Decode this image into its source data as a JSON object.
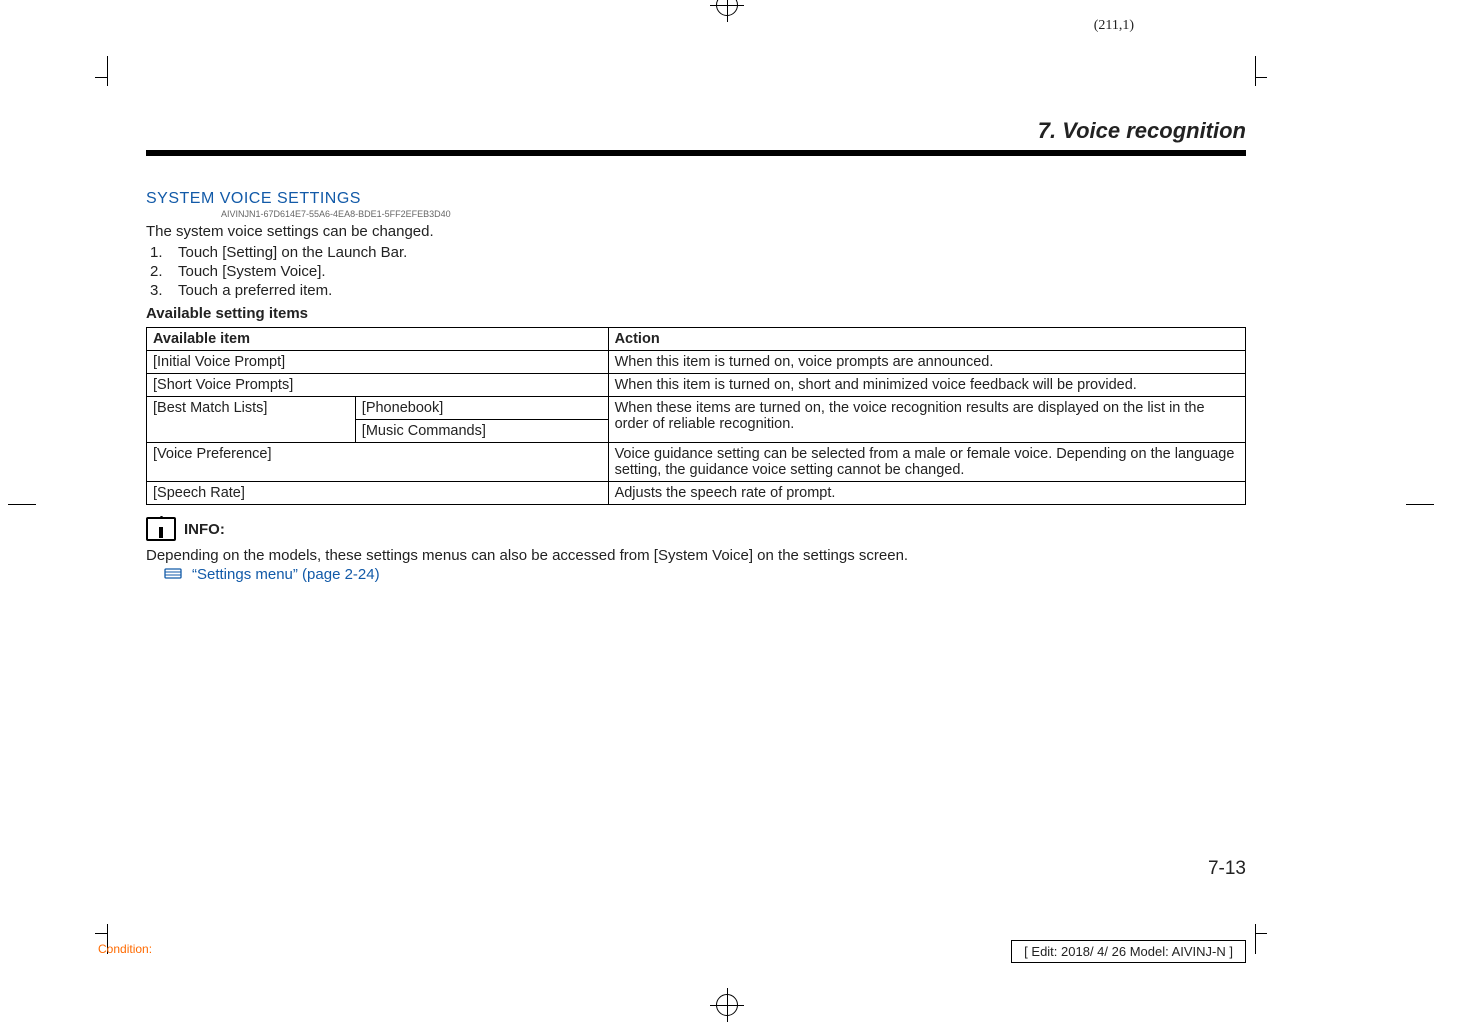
{
  "meta": {
    "corner_page": "(211,1)",
    "condition_label": "Condition:",
    "edit_info": "[ Edit: 2018/ 4/ 26   Model:  AIVINJ-N ]",
    "page_number": "7-13"
  },
  "chapter_title": "7. Voice recognition",
  "section": {
    "heading": "SYSTEM VOICE SETTINGS",
    "guid": "AIVINJN1-67D614E7-55A6-4EA8-BDE1-5FF2EFEB3D40",
    "intro": "The system voice settings can be changed.",
    "steps": [
      "Touch [Setting] on the Launch Bar.",
      "Touch [System Voice].",
      "Touch a preferred item."
    ],
    "subhead": "Available setting items"
  },
  "table": {
    "header_item": "Available item",
    "header_action": "Action",
    "rows": {
      "initial_voice_prompt": {
        "item": "[Initial Voice Prompt]",
        "action": "When this item is turned on, voice prompts are announced."
      },
      "short_voice_prompts": {
        "item": "[Short Voice Prompts]",
        "action": "When this item is turned on, short and minimized voice feedback will be provided."
      },
      "best_match": {
        "item": "[Best Match Lists]",
        "sub1": "[Phonebook]",
        "sub2": "[Music Commands]",
        "action": "When these items are turned on, the voice recognition results are displayed on the list in the order of reliable recognition."
      },
      "voice_preference": {
        "item": "[Voice Preference]",
        "action": "Voice guidance setting can be selected from a male or female voice. Depending on the language setting, the guidance voice setting cannot be changed."
      },
      "speech_rate": {
        "item": "[Speech Rate]",
        "action": "Adjusts the speech rate of prompt."
      }
    }
  },
  "info": {
    "label": "INFO:",
    "text": "Depending on the models, these settings menus can also be accessed from [System Voice] on the settings screen.",
    "ref": "“Settings menu” (page 2-24)"
  }
}
